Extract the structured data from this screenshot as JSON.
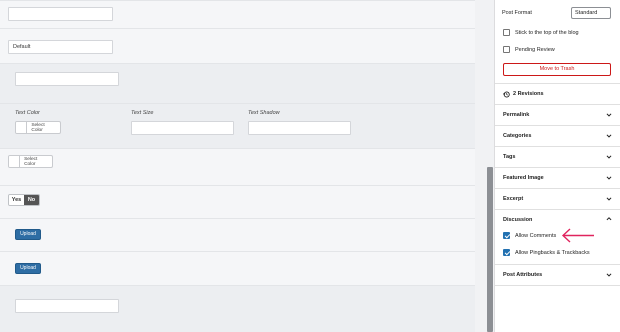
{
  "main": {
    "fields": {
      "top_input_value": "",
      "default_input_value": "Default",
      "third_input_value": ""
    },
    "typography": {
      "text_color_label": "Text Color",
      "text_size_label": "Text Size",
      "text_shadow_label": "Text Shadow",
      "select_color_label": "Select Color",
      "text_size_value": "",
      "text_shadow_value": ""
    },
    "second_color": {
      "select_color_label": "Select Color"
    },
    "toggle": {
      "yes_label": "Yes",
      "no_label": "No",
      "selected": "No"
    },
    "upload_buttons": [
      {
        "label": "Upload"
      },
      {
        "label": "Upload"
      }
    ],
    "bottom_input_value": ""
  },
  "sidebar": {
    "post_format": {
      "label": "Post Format",
      "selected": "Standard"
    },
    "stick_to_top": {
      "label": "Stick to the top of the blog",
      "checked": false
    },
    "pending_review": {
      "label": "Pending Review",
      "checked": false
    },
    "move_to_trash_label": "Move to Trash",
    "revisions_label": "2 Revisions",
    "panels": [
      {
        "title": "Permalink",
        "expanded": false
      },
      {
        "title": "Categories",
        "expanded": false
      },
      {
        "title": "Tags",
        "expanded": false
      },
      {
        "title": "Featured Image",
        "expanded": false
      },
      {
        "title": "Excerpt",
        "expanded": false
      },
      {
        "title": "Discussion",
        "expanded": true
      },
      {
        "title": "Post Attributes",
        "expanded": false
      }
    ],
    "discussion": {
      "allow_comments": {
        "label": "Allow Comments",
        "checked": true
      },
      "allow_pingbacks": {
        "label": "Allow Pingbacks & Trackbacks",
        "checked": true
      }
    }
  },
  "colors": {
    "accent_blue": "#2271b1",
    "upload_blue": "#2e6da4",
    "trash_red": "#cc1818",
    "annotation_arrow": "#e0245e"
  },
  "icons": {
    "revisions": "history-icon",
    "panel_collapsed": "chevron-down-icon",
    "panel_expanded": "chevron-up-icon",
    "annotation": "arrow-left-icon"
  }
}
